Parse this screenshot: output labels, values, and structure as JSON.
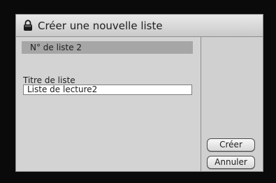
{
  "dialog": {
    "title": "Créer une nouvelle liste",
    "title_icon": "lock-icon"
  },
  "list_number": {
    "text": "N° de liste 2"
  },
  "list_title": {
    "label": "Titre de liste",
    "value": "Liste de lecture2"
  },
  "buttons": {
    "create_label": "Créer",
    "cancel_label": "Annuler"
  },
  "colors": {
    "dialog_bg": "#cfcfcf",
    "list_number_bar": "#a6a6a6",
    "input_bg": "#ffffff",
    "screen_bg": "#0a0a0a"
  }
}
